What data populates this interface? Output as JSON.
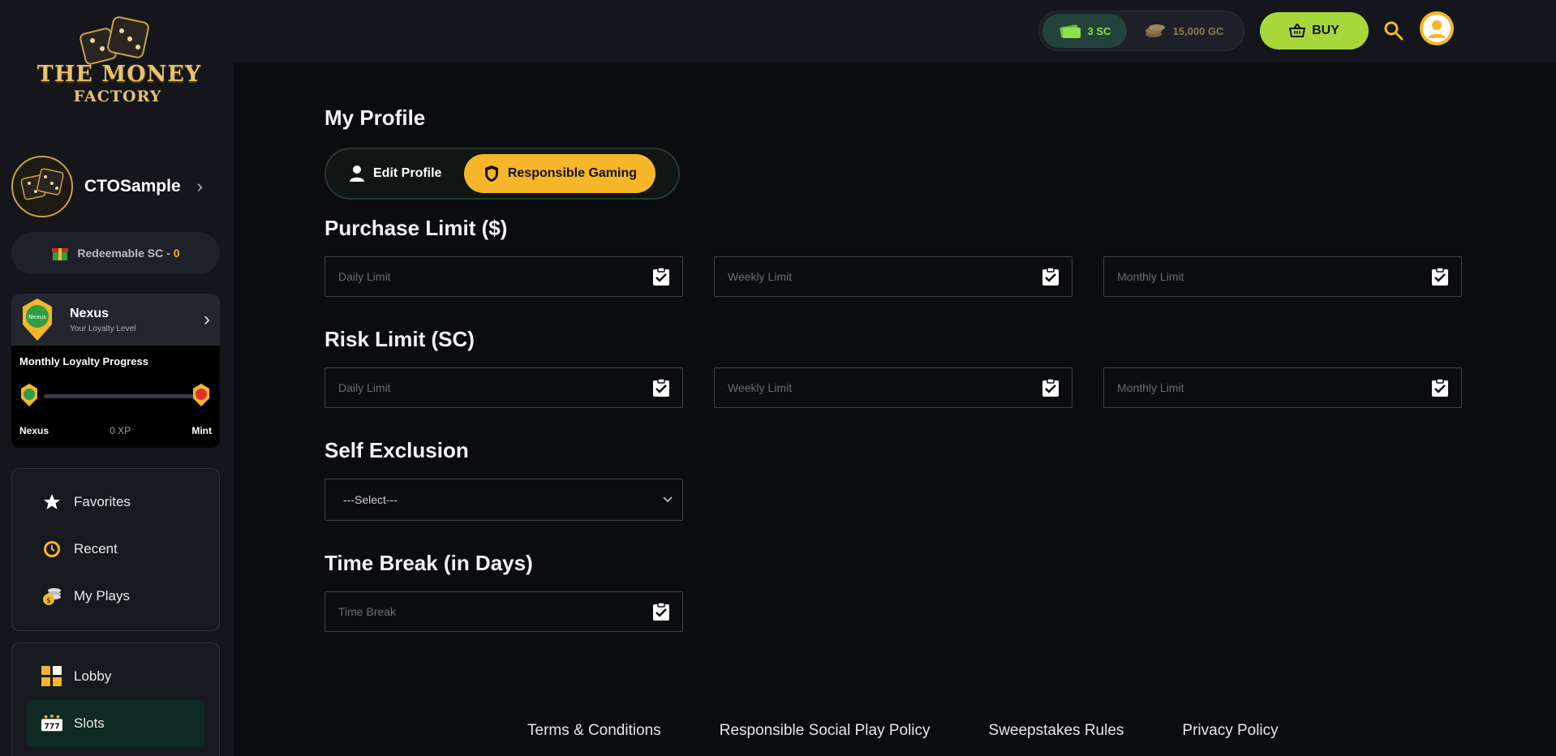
{
  "brand": {
    "logo_line1": "THE MONEY",
    "logo_line2": "FACTORY"
  },
  "user": {
    "name": "CTOSample"
  },
  "redeemable": {
    "label": "Redeemable SC -",
    "value": "0"
  },
  "loyalty": {
    "level": "Nexus",
    "subtitle": "Your Loyalty Level",
    "progress_title": "Monthly Loyalty Progress",
    "start_label": "Nexus",
    "xp": "0 XP",
    "end_label": "Mint",
    "progress": 0
  },
  "sidebar": {
    "quick": [
      {
        "label": "Favorites",
        "icon": "star-icon"
      },
      {
        "label": "Recent",
        "icon": "clock-icon"
      },
      {
        "label": "My Plays",
        "icon": "coins-icon"
      }
    ],
    "nav": [
      {
        "label": "Lobby",
        "icon": "grid-icon"
      },
      {
        "label": "Slots",
        "icon": "slot-777-icon"
      }
    ]
  },
  "topbar": {
    "sc": "3 SC",
    "gc": "15,000 GC",
    "buy_label": "BUY"
  },
  "profile": {
    "title": "My Profile",
    "tabs": [
      "Edit Profile",
      "Responsible Gaming"
    ]
  },
  "purchase_limit": {
    "title": "Purchase Limit ($)",
    "placeholders": [
      "Daily Limit",
      "Weekly Limit",
      "Monthly Limit"
    ]
  },
  "risk_limit": {
    "title": "Risk Limit (SC)",
    "placeholders": [
      "Daily Limit",
      "Weekly Limit",
      "Monthly Limit"
    ]
  },
  "self_exclusion": {
    "title": "Self Exclusion",
    "selected": "---Select---"
  },
  "time_break": {
    "title": "Time Break (in Days)",
    "placeholder": "Time Break"
  },
  "footer": {
    "links": [
      "Terms & Conditions",
      "Responsible Social Play Policy",
      "Sweepstakes Rules",
      "Privacy Policy"
    ]
  },
  "colors": {
    "accent": "#f5b62a",
    "buy": "#a7d83b",
    "sc_green": "#8ee04a"
  }
}
